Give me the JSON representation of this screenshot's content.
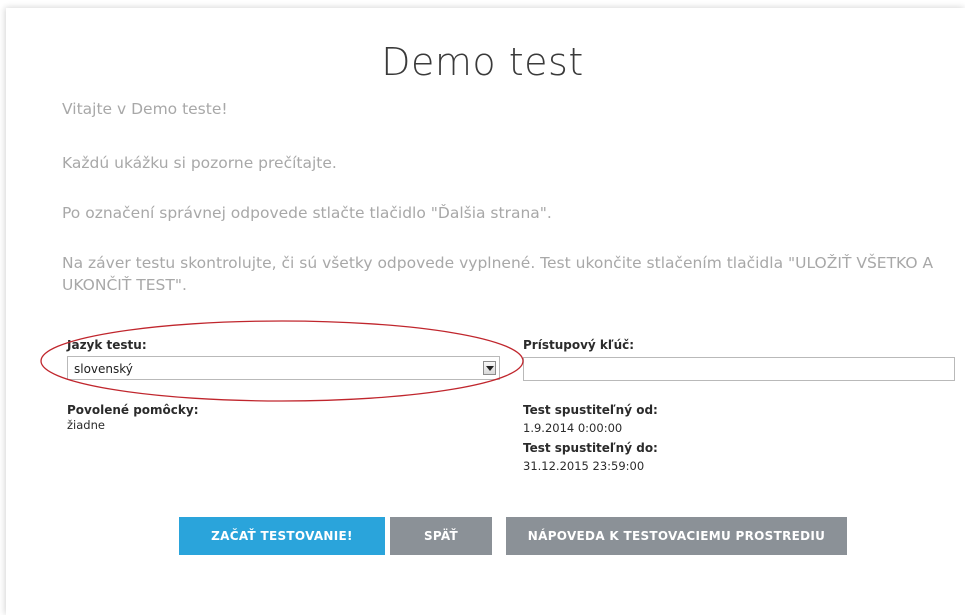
{
  "page": {
    "title": "Demo test",
    "intro": [
      "Vitajte v Demo teste!",
      "Každú ukážku si pozorne prečítajte.",
      "Po označení správnej odpovede stlačte tlačidlo \"Ďalšia strana\".",
      "Na záver testu skontrolujte, či sú všetky odpovede vyplnené. Test ukončite stlačením tlačidla \"ULOŽIŤ VŠETKO A UKONČIŤ TEST\"."
    ]
  },
  "form": {
    "language_label": "Jazyk testu:",
    "language_value": "slovenský",
    "access_key_label": "Prístupový kľúč:",
    "access_key_value": "",
    "aids_label": "Povolené pomôcky:",
    "aids_value": "žiadne",
    "start_label": "Test spustiteľný od:",
    "start_value": "1.9.2014 0:00:00",
    "end_label": "Test spustiteľný do:",
    "end_value": "31.12.2015 23:59:00"
  },
  "buttons": {
    "start": "ZAČAŤ TESTOVANIE!",
    "back": "SPÄŤ",
    "help": "NÁPOVEDA K TESTOVACIEMU PROSTREDIU"
  },
  "colors": {
    "primary_button": "#2aa4db",
    "secondary_button": "#8b9197",
    "annotation_ellipse": "#c0262d"
  },
  "icons": {
    "dropdown": "chevron-down-icon"
  }
}
